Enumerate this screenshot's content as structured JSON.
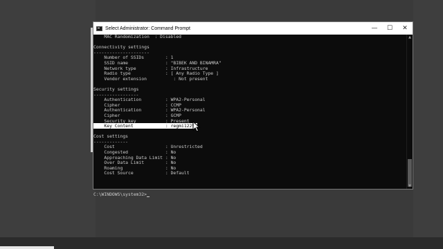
{
  "window": {
    "title": "Select Administrator: Command Prompt",
    "controls": {
      "minimize": "—",
      "maximize": "☐",
      "close": "✕"
    }
  },
  "console_lines": [
    "    MAC Randomization  : Disabled",
    "",
    "Connectivity settings",
    "---------------------",
    "    Number of SSIDs        : 1",
    "    SSID name              : \"BIBEK AND BINAMRA\"",
    "    Network type           : Infrastructure",
    "    Radio type             : [ Any Radio Type ]",
    "    Vendor extension          : Not present",
    "",
    "Security settings",
    "-----------------",
    "    Authentication         : WPA2-Personal",
    "    Cipher                 : CCMP",
    "    Authentication         : WPA2-Personal",
    "    Cipher                 : GCMP",
    "    Security key           : Present",
    "    Key Content            : regmi12250",
    "",
    "Cost settings",
    "-------------",
    "    Cost                   : Unrestricted",
    "    Congested              : No",
    "    Approaching Data Limit : No",
    "    Over Data Limit        : No",
    "    Roaming                : No",
    "    Cost Source            : Default",
    "",
    "",
    "",
    "C:\\WINDOWS\\system32>"
  ],
  "highlighted_line_index": 17,
  "colors": {
    "console_bg": "#0c0c0c",
    "console_fg": "#cccccc",
    "highlight_bg": "#ffffff"
  },
  "icons": {
    "app": "cmd-icon",
    "pointer": "mouse-pointer-icon"
  }
}
